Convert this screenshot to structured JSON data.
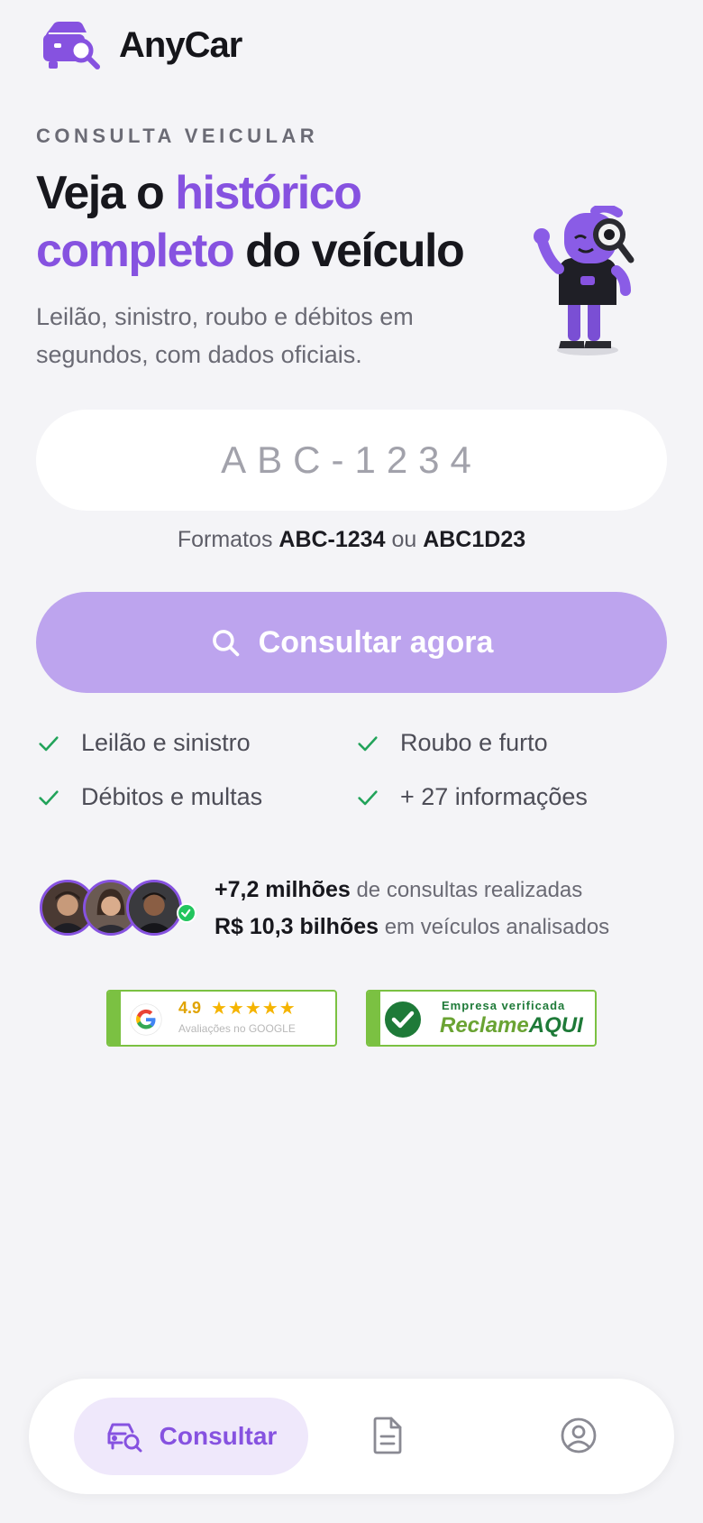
{
  "brand": {
    "name": "AnyCar"
  },
  "hero": {
    "eyebrow": "CONSULTA VEICULAR",
    "headline_part1": "Veja o ",
    "headline_accent1": "histórico",
    "headline_accent2": "completo",
    "headline_part2": " do veículo",
    "subtitle": "Leilão, sinistro, roubo e débitos em segundos, com dados oficiais."
  },
  "search": {
    "placeholder": "ABC-1234",
    "formats_prefix": "Formatos ",
    "format1": "ABC-1234",
    "formats_or": " ou ",
    "format2": "ABC1D23",
    "cta_label": "Consultar agora"
  },
  "features": [
    "Leilão e sinistro",
    "Roubo e furto",
    "Débitos e multas",
    "+ 27 informações"
  ],
  "social_proof": {
    "consultas_value": "+7,2 milhões",
    "consultas_text": " de consultas realizadas",
    "veiculos_value": "R$ 10,3 bilhões",
    "veiculos_text": " em veículos analisados"
  },
  "badges": {
    "google_rating": "4.9",
    "google_stars": "★★★★★",
    "google_caption": "Avaliações no GOOGLE",
    "ra_caption": "Empresa verificada",
    "ra_reclame": "Reclame",
    "ra_aqui": "AQUI"
  },
  "nav": {
    "consultar_label": "Consultar"
  },
  "colors": {
    "accent": "#8652e0",
    "cta": "#bda4ee",
    "check": "#22a35a",
    "badge_green": "#7bc142"
  }
}
